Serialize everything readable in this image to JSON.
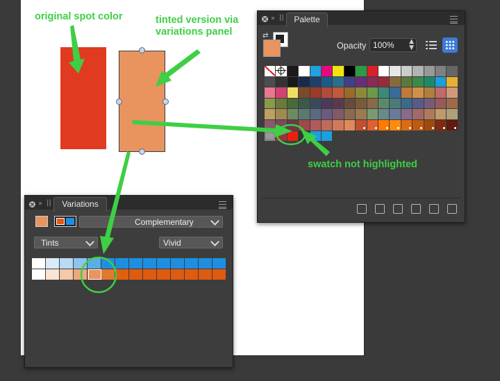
{
  "annotations": {
    "original": "original spot color",
    "tinted_line1": "tinted version via",
    "tinted_line2": "variations panel",
    "swatch_note": "swatch not highlighted",
    "color": "#3ecf45"
  },
  "canvas": {
    "spot_color": "#e03a20",
    "tint_color": "#e9935f"
  },
  "palette_panel": {
    "tab_label": "Palette",
    "opacity_label": "Opacity",
    "opacity_value": "100%",
    "fill_color": "#e9935f",
    "icons": [
      "list-view-icon",
      "grid-view-icon"
    ],
    "tools": [
      "edit-swatch-icon",
      "add-swatch-icon",
      "add-from-document-icon",
      "edit-icon",
      "delete-icon",
      "palette-options-icon"
    ],
    "swatch_rows": [
      [
        "#ffffff",
        "#ffffff",
        "#1a1a1a",
        "#ffffff",
        "#1fa3e0",
        "#e5087e",
        "#f4e210",
        "#000000",
        "#2d9a46",
        "#d92028",
        "#ffffff",
        "#e6e6e6",
        "#cccccc",
        "#b3b3b3",
        "#999999",
        "#808080",
        "#666666"
      ],
      [
        "#4d4d4d",
        "#333333",
        "#1a1a1a",
        "#1a2a4a",
        "#1e3f6e",
        "#1c5a8a",
        "#2a6f8c",
        "#3f3f8c",
        "#6a2d7a",
        "#8a2a5a",
        "#9a2a3a",
        "#8a6a3a",
        "#5a7a3a",
        "#3a8a4a",
        "#1a8a6a",
        "#1aa0d8",
        "#e8b030"
      ],
      [
        "#e87890",
        "#d44070",
        "#f0e060",
        "#7a4a2a",
        "#9a3a2a",
        "#b04a3a",
        "#c05a3a",
        "#9a6a2a",
        "#8a8a3a",
        "#6a9a4a",
        "#3a8a7a",
        "#3a6a9a",
        "#c07a3a",
        "#d0904a",
        "#b0803a",
        "#c06a6a",
        "#d09a7a"
      ],
      [
        "#8a9a4a",
        "#6a7a3a",
        "#4a6a3a",
        "#3a5a4a",
        "#3a4a5a",
        "#4a3a5a",
        "#5a3a4a",
        "#6a4a3a",
        "#7a5a3a",
        "#8a6a4a",
        "#5a8a6a",
        "#4a7a7a",
        "#3a6a8a",
        "#5a5a8a",
        "#7a5a7a",
        "#9a5a5a",
        "#a06a4a"
      ],
      [
        "#c0a060",
        "#a08a50",
        "#708a60",
        "#5a7a70",
        "#5a6a80",
        "#6a5a80",
        "#805a6a",
        "#8a6a50",
        "#9a7a50",
        "#7a9a70",
        "#6a8a8a",
        "#6a7a9a",
        "#8a6a8a",
        "#a06a6a",
        "#b07a5a",
        "#c09a6a",
        "#b0a07a"
      ],
      [
        "#8a5a6a",
        "#7a4a5a",
        "#6a3a4a",
        "#9a4a4a",
        "#b05a5a",
        "#c06a5a",
        "#d07a5a",
        "#e08a5a",
        "#c05030",
        "#e06030",
        "#ff7a00",
        "#ff8a10",
        "#e06a10",
        "#c05a10",
        "#a04a10",
        "#802a10",
        "#601a10"
      ],
      [
        "#888888",
        "#a03040",
        "#e82010",
        "#333333",
        "#1aa0e0",
        "#1aa0e0"
      ]
    ]
  },
  "variations_panel": {
    "tab_label": "Variations",
    "swatch_colors": [
      "#e9935f",
      "#e05a10",
      "#1e8fe0"
    ],
    "mode_value": "Complementary",
    "type_value": "Tints",
    "style_value": "Vivid",
    "row_top": [
      "#ffffff",
      "#d8ebf8",
      "#b8daf4",
      "#8cc4ee",
      "#5aaee8",
      "#1e8fe0",
      "#1e8fe0",
      "#1e8fe0",
      "#1e8fe0",
      "#1e8fe0",
      "#1e8fe0",
      "#1e8fe0",
      "#1e8fe0",
      "#1e8fe0"
    ],
    "row_bottom": [
      "#ffffff",
      "#fbe4d4",
      "#f4c8a8",
      "#ecaa7c",
      "#e9935f",
      "#e07830",
      "#e06010",
      "#e05a10",
      "#e05a10",
      "#e05a10",
      "#e05a10",
      "#e05a10",
      "#e05a10",
      "#e05a10"
    ]
  }
}
